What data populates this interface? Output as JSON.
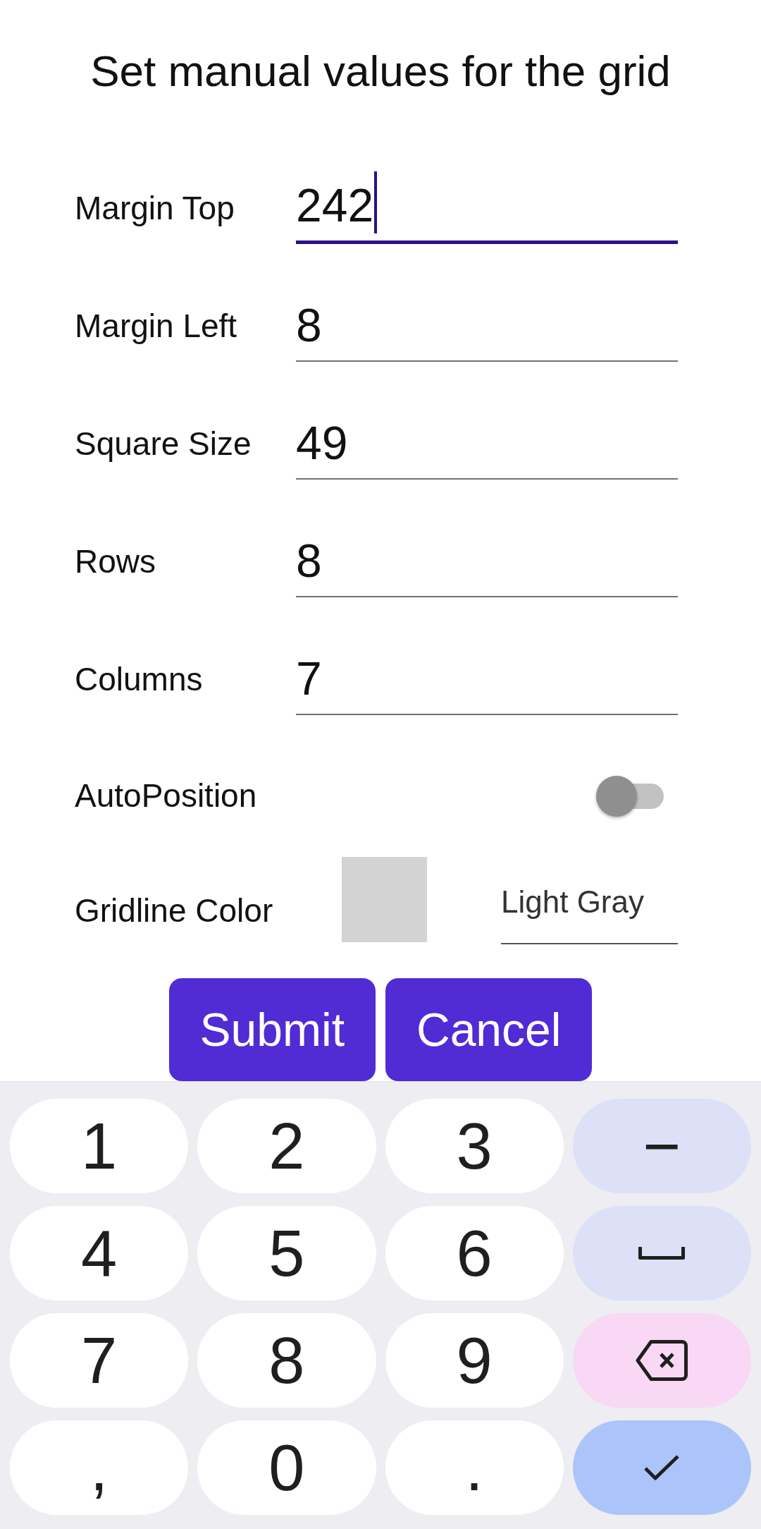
{
  "title": "Set manual values for the grid",
  "fields": [
    {
      "label": "Margin Top",
      "value": "242",
      "focused": true
    },
    {
      "label": "Margin Left",
      "value": "8",
      "focused": false
    },
    {
      "label": "Square Size",
      "value": "49",
      "focused": false
    },
    {
      "label": "Rows",
      "value": "8",
      "focused": false
    },
    {
      "label": "Columns",
      "value": "7",
      "focused": false
    }
  ],
  "auto_position": {
    "label": "AutoPosition",
    "on": false
  },
  "gridline_color": {
    "label": "Gridline Color",
    "color": "#d3d3d3",
    "value": "Light Gray"
  },
  "buttons": [
    "Submit",
    "Cancel"
  ],
  "keyboard": {
    "keys": [
      {
        "kind": "char",
        "label": "1"
      },
      {
        "kind": "char",
        "label": "2"
      },
      {
        "kind": "char",
        "label": "3"
      },
      {
        "kind": "action",
        "label": "−"
      },
      {
        "kind": "char",
        "label": "4"
      },
      {
        "kind": "char",
        "label": "5"
      },
      {
        "kind": "char",
        "label": "6"
      },
      {
        "kind": "space"
      },
      {
        "kind": "char",
        "label": "7"
      },
      {
        "kind": "char",
        "label": "8"
      },
      {
        "kind": "char",
        "label": "9"
      },
      {
        "kind": "backspace"
      },
      {
        "kind": "char",
        "label": ","
      },
      {
        "kind": "char",
        "label": "0"
      },
      {
        "kind": "char",
        "label": "."
      },
      {
        "kind": "enter"
      }
    ]
  }
}
